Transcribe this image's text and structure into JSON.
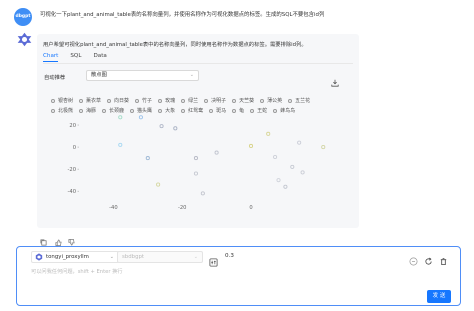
{
  "user_avatar_text": "dbgpt",
  "user_message": "可视化一下plant_and_animal_table表的名称向量列，并使用名称作为可视化数据点的标签。生成的SQL不要包含id列",
  "assistant_message": "用户希望可视化plant_and_animal_table表中的名称向量列，同时使用名称作为数据点的标签。需要排除id列。",
  "tabs": [
    {
      "label": "Chart",
      "active": true
    },
    {
      "label": "SQL",
      "active": false
    },
    {
      "label": "Data",
      "active": false
    }
  ],
  "chart_type_label": "自动推荐",
  "chart_type_value": "散点图",
  "chart_data": {
    "type": "scatter",
    "title": "",
    "xlabel": "",
    "ylabel": "",
    "x_ticks": [
      "-40",
      "-20",
      "0"
    ],
    "y_ticks": [
      "20",
      "0",
      "-20",
      "-40"
    ],
    "xlim": [
      -50,
      25
    ],
    "ylim": [
      -48,
      30
    ],
    "legend": [
      "银杏树",
      "薰衣草",
      "向日葵",
      "竹子",
      "玫瑰",
      "绿兰",
      "决明子",
      "天竺葵",
      "薄公英",
      "五兰花",
      "北极熊",
      "海豚",
      "长颈鹿",
      "猫头鹰",
      "大象",
      "红鸳鸯",
      "斑马",
      "龟",
      "王蛇",
      "蜂鸟鸟"
    ],
    "points": [
      {
        "name": "银杏树",
        "x": -32,
        "y": 27,
        "color": "#9dc3ea"
      },
      {
        "name": "薰衣草",
        "x": -26,
        "y": 19,
        "color": "#b0b7c8"
      },
      {
        "name": "向日葵",
        "x": -38,
        "y": 27,
        "color": "#a4ddc9"
      },
      {
        "name": "竹子",
        "x": -38,
        "y": 2,
        "color": "#a7d8f2"
      },
      {
        "name": "玫瑰",
        "x": -27,
        "y": -34,
        "color": "#d6d8a3"
      },
      {
        "name": "绿兰",
        "x": -16,
        "y": -10,
        "color": "#b7bac6"
      },
      {
        "name": "决明子",
        "x": -10,
        "y": -5,
        "color": "#c0c4cf"
      },
      {
        "name": "天竺葵",
        "x": 0,
        "y": 1,
        "color": "#d8d48c"
      },
      {
        "name": "薄公英",
        "x": 5,
        "y": 12,
        "color": "#d9d79a"
      },
      {
        "name": "五兰花",
        "x": 7,
        "y": -9,
        "color": "#cdd0d9"
      },
      {
        "name": "北极熊",
        "x": 8,
        "y": -30,
        "color": "#d0d3db"
      },
      {
        "name": "海豚",
        "x": 10,
        "y": -36,
        "color": "#c2c6d0"
      },
      {
        "name": "长颈鹿",
        "x": 12,
        "y": -18,
        "color": "#c6cad3"
      },
      {
        "name": "猫头鹰",
        "x": 15,
        "y": -23,
        "color": "#cacdd6"
      },
      {
        "name": "大象",
        "x": -16,
        "y": -24,
        "color": "#c6c9d2"
      },
      {
        "name": "红鸳鸯",
        "x": -22,
        "y": 17,
        "color": "#a9b2c4"
      },
      {
        "name": "斑马",
        "x": -14,
        "y": -42,
        "color": "#c2c5ce"
      },
      {
        "name": "龟",
        "x": -30,
        "y": -10,
        "color": "#9fb9d6"
      },
      {
        "name": "王蛇",
        "x": 14,
        "y": 4,
        "color": "#cbced8"
      },
      {
        "name": "蜂鸟鸟",
        "x": 21,
        "y": 0,
        "color": "#d3d6a7"
      }
    ]
  },
  "input": {
    "model": "tongyi_proxyllm",
    "database": "sbdbgpt",
    "temperature": "0.3",
    "placeholder": "可以问我任何问题，shift + Enter 换行",
    "send_label": "发 送"
  },
  "colors": {
    "accent": "#1677ff",
    "input_border": "#4f8ef7",
    "card_bg": "#f6f7f9"
  }
}
